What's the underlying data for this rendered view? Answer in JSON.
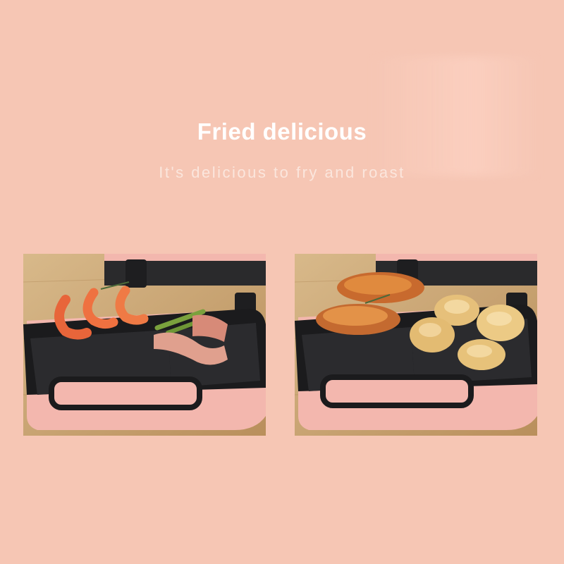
{
  "heading": {
    "title": "Fried delicious",
    "subtitle": "It's delicious to fry and roast"
  },
  "photos": [
    {
      "subject": "sandwich maker with grilled shrimp, asparagus and bacon"
    },
    {
      "subject": "sandwich maker with grilled chicken wings and dumplings"
    }
  ],
  "colors": {
    "background": "#f6c6b4",
    "appliance_pink": "#f3b7ae",
    "plate_black": "#1b1b1d",
    "wood": "#c9a26c"
  }
}
